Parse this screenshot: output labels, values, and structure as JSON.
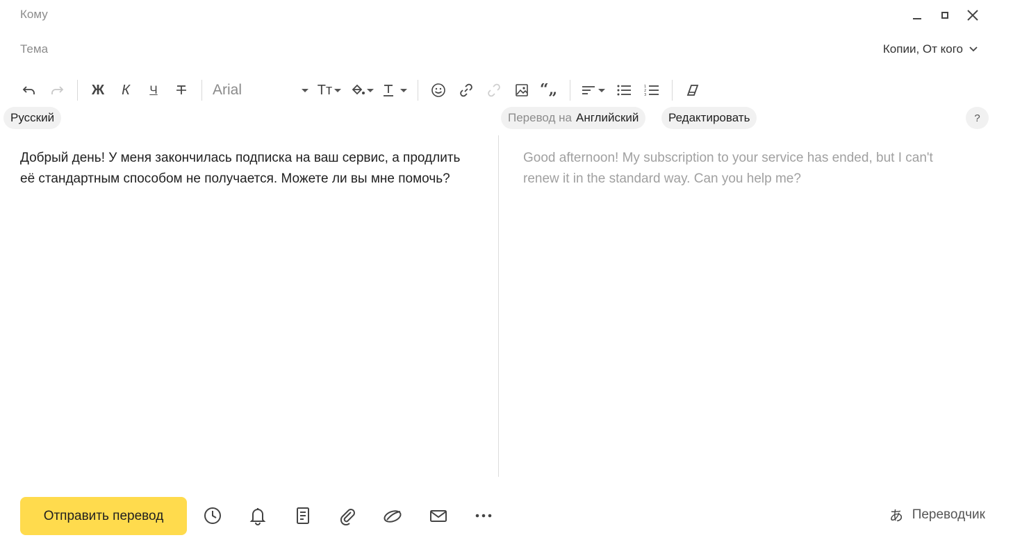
{
  "compose": {
    "to_placeholder": "Кому",
    "subject_placeholder": "Тема",
    "cc_toggle_label": "Копии, От кого"
  },
  "toolbar": {
    "bold_label": "Ж",
    "italic_label": "К",
    "underline_label": "Ч",
    "font_family_value": "Arial",
    "font_size_label": "Тт"
  },
  "translation": {
    "source_language": "Русский",
    "target_prefix": "Перевод на",
    "target_language": "Английский",
    "edit_label": "Редактировать",
    "help_label": "?",
    "source_text": "Добрый день! У меня закончилась подписка на ваш сервис, а продлить её стандартным способом не получается. Можете ли вы мне помочь?",
    "translated_text": "Good afternoon! My subscription to your service has ended, but I can't renew it in the standard way. Can you help me?"
  },
  "footer": {
    "send_label": "Отправить перевод",
    "translator_label": "Переводчик",
    "icons": [
      "clock-icon",
      "bell-icon",
      "template-icon",
      "attach-icon",
      "cloud-attach-icon",
      "envelope-icon",
      "more-icon"
    ]
  },
  "colors": {
    "accent": "#ffdb4d",
    "chip_bg": "#f1f1f1",
    "muted_text": "#8c8c8c",
    "translated_text": "#a0a0a0"
  }
}
